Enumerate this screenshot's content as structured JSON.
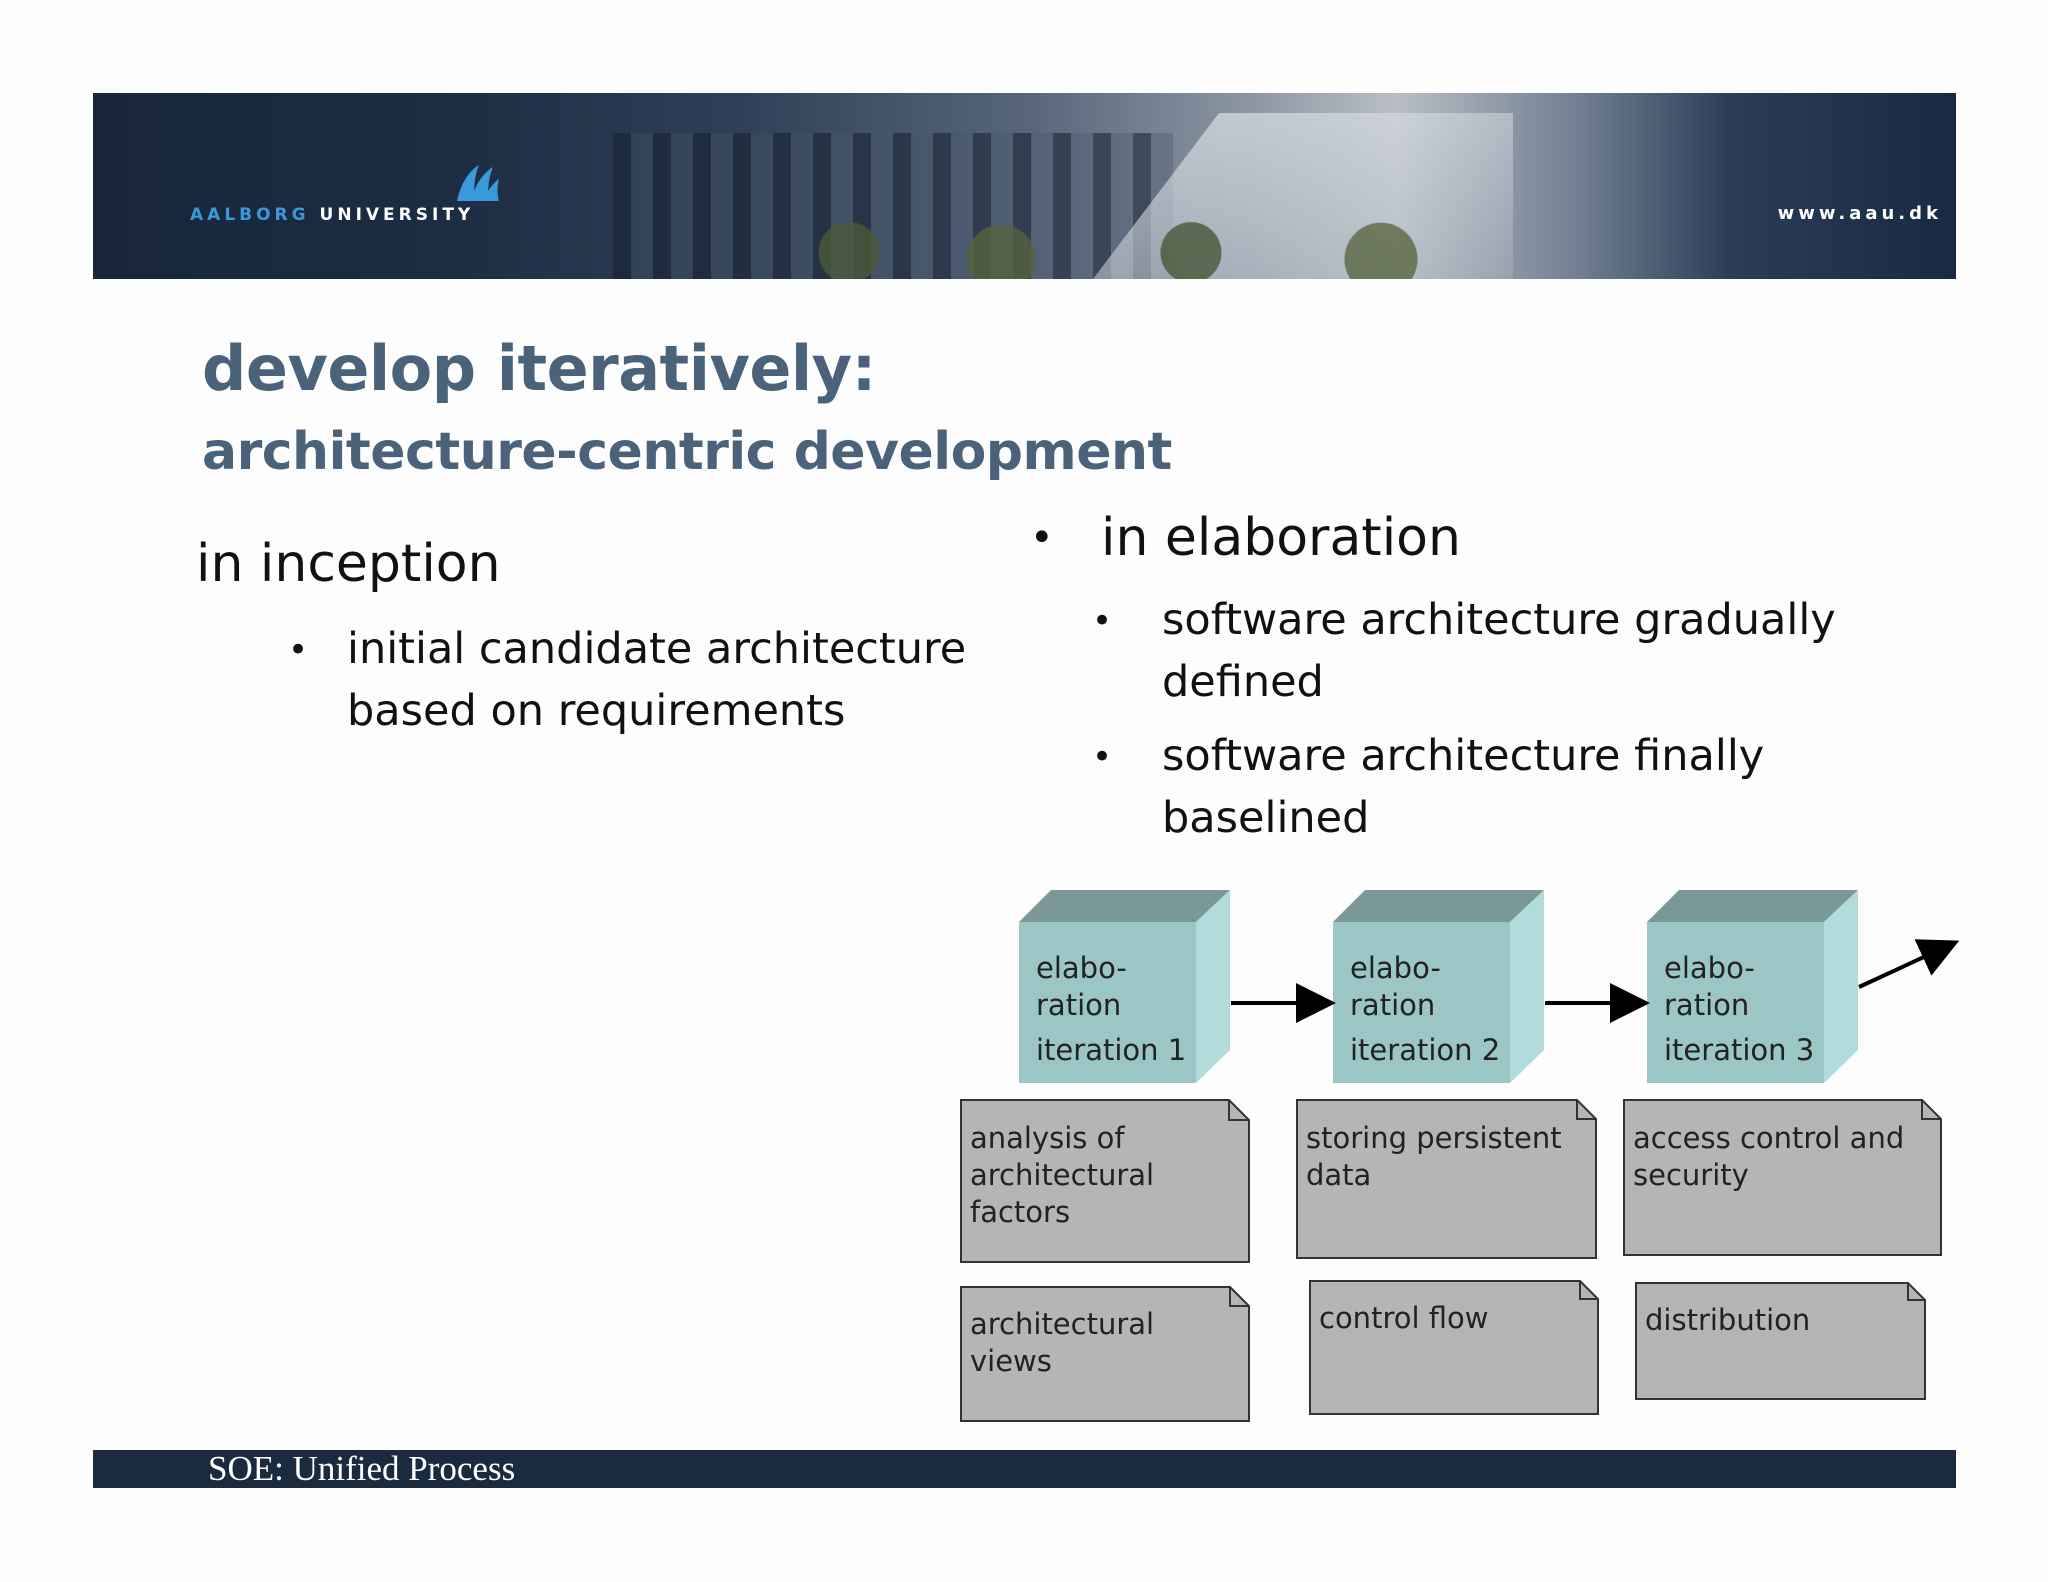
{
  "header": {
    "university_prefix": "AALBORG",
    "university_suffix": "UNIVERSITY",
    "url": "www.aau.dk",
    "logo_icon": "aau-logo-icon"
  },
  "title": "develop iteratively:",
  "subtitle": "architecture-centric development",
  "inception": {
    "heading": "in inception",
    "bullets": [
      {
        "line1": "initial candidate architecture",
        "line2": "based on requirements"
      }
    ]
  },
  "elaboration": {
    "heading": "in elaboration",
    "bullets": [
      {
        "line1": "software architecture gradually",
        "line2": "defined"
      },
      {
        "line1": "software architecture finally",
        "line2": "baselined"
      }
    ]
  },
  "diagram": {
    "iterations": [
      {
        "line1": "elabo-",
        "line2": "ration",
        "line3": "iteration 1"
      },
      {
        "line1": "elabo-",
        "line2": "ration",
        "line3": "iteration 2"
      },
      {
        "line1": "elabo-",
        "line2": "ration",
        "line3": "iteration 3"
      }
    ],
    "notes_row1": [
      "analysis of architectural factors",
      "storing persistent data",
      "access control and security"
    ],
    "notes_row2": [
      "architectural views",
      "control flow",
      "distribution"
    ],
    "colors": {
      "cube_front": "#9cc6c6",
      "cube_top": "#7a9898",
      "cube_side": "#b2dcdc",
      "note_fill": "#b7b4b7"
    }
  },
  "footer": {
    "text": "SOE: Unified Process"
  }
}
